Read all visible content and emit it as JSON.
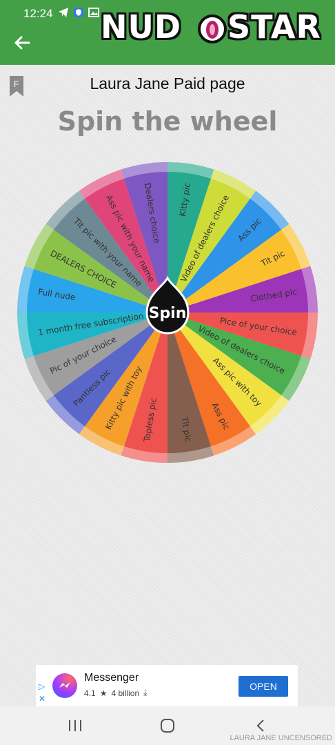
{
  "status": {
    "time": "12:24"
  },
  "brand": {
    "left": "NUD",
    "right": "STAR"
  },
  "page": {
    "title": "Laura Jane Paid page",
    "heading": "Spin the wheel"
  },
  "wheel": {
    "center_label": "Spin",
    "segments": [
      {
        "label": "Kitty pic",
        "color": "#27a98f"
      },
      {
        "label": "Video of dealers choice",
        "color": "#cddc39"
      },
      {
        "label": "Ass pic",
        "color": "#2f93e7"
      },
      {
        "label": "Tit pic",
        "color": "#fbc02d"
      },
      {
        "label": "Clothed pic",
        "color": "#9c35b8"
      },
      {
        "label": "Pice of your choice",
        "color": "#ef5350"
      },
      {
        "label": "Video of dealers choice",
        "color": "#4caf50"
      },
      {
        "label": "Ass pic with toy",
        "color": "#f0e140"
      },
      {
        "label": "Ass pic",
        "color": "#f57128"
      },
      {
        "label": "Tit pic",
        "color": "#855f4e"
      },
      {
        "label": "Topless pic",
        "color": "#ef5350"
      },
      {
        "label": "Kitty pic with toy",
        "color": "#f4a02a"
      },
      {
        "label": "Pantless pic",
        "color": "#5a67c9"
      },
      {
        "label": "Pic of your choice",
        "color": "#9e9e9e"
      },
      {
        "label": "1 month free subscription",
        "color": "#1fb5c8"
      },
      {
        "label": "Full nude",
        "color": "#2aa4ea"
      },
      {
        "label": "DEALERS CHOICE",
        "color": "#8bc34a"
      },
      {
        "label": "Tit pic with your name",
        "color": "#6d8a94"
      },
      {
        "label": "Ass pic with your name",
        "color": "#e0457a"
      },
      {
        "label": "Dealers choice",
        "color": "#7e57c2"
      }
    ]
  },
  "ad": {
    "app_name": "Messenger",
    "rating": "4.1",
    "downloads": "4 billion",
    "button": "OPEN"
  },
  "watermark": "LAURA JANE UNCENSORED"
}
